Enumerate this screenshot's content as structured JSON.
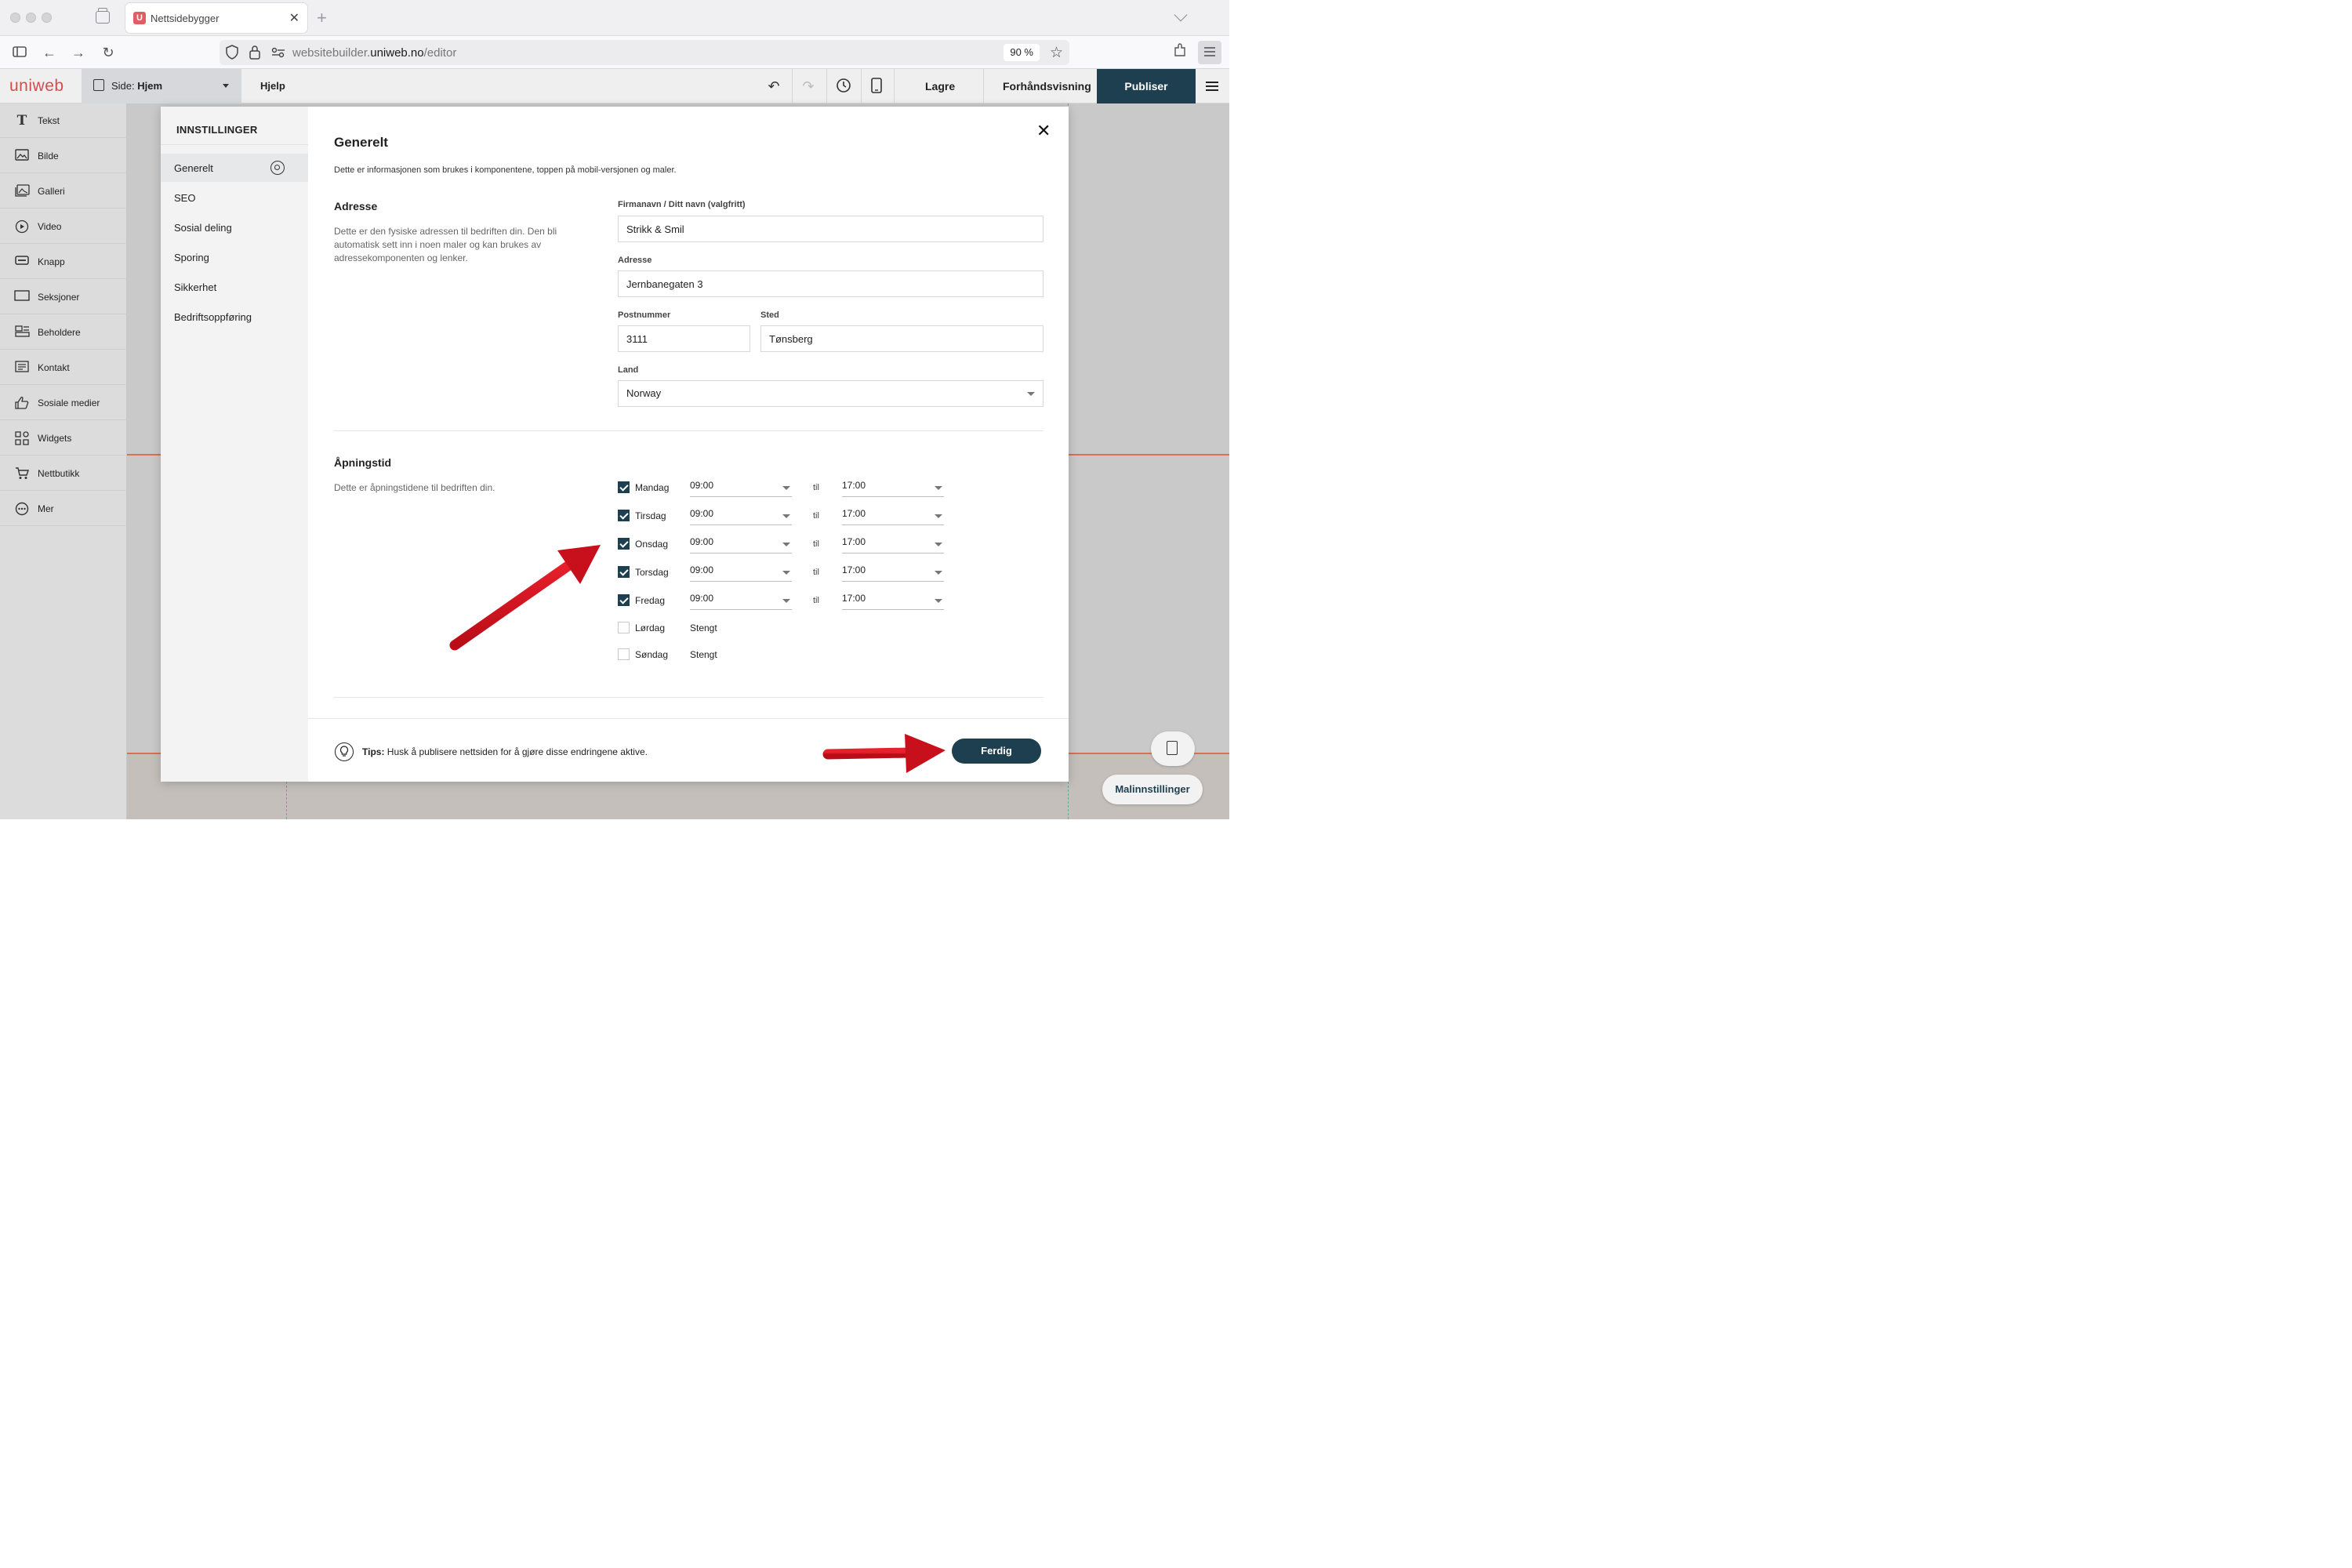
{
  "browser": {
    "tab_title": "Nettsidebygger",
    "tab_favicon_letter": "U",
    "url_host_prefix": "websitebuilder.",
    "url_host_main": "uniweb.no",
    "url_path": "/editor",
    "zoom": "90 %"
  },
  "editor": {
    "logo": "uniweb",
    "page_prefix": "Side:",
    "page_name": "Hjem",
    "help": "Hjelp",
    "save": "Lagre",
    "preview": "Forhåndsvisning",
    "publish": "Publiser"
  },
  "tools": [
    {
      "label": "Tekst",
      "icon": "text-icon"
    },
    {
      "label": "Bilde",
      "icon": "image-icon"
    },
    {
      "label": "Galleri",
      "icon": "gallery-icon"
    },
    {
      "label": "Video",
      "icon": "video-icon"
    },
    {
      "label": "Knapp",
      "icon": "button-icon"
    },
    {
      "label": "Seksjoner",
      "icon": "sections-icon"
    },
    {
      "label": "Beholdere",
      "icon": "containers-icon"
    },
    {
      "label": "Kontakt",
      "icon": "contact-icon"
    },
    {
      "label": "Sosiale medier",
      "icon": "thumbs-up-icon"
    },
    {
      "label": "Widgets",
      "icon": "widgets-icon"
    },
    {
      "label": "Nettbutikk",
      "icon": "cart-icon"
    },
    {
      "label": "Mer",
      "icon": "more-icon"
    }
  ],
  "settings": {
    "title": "INNSTILLINGER",
    "nav": [
      {
        "label": "Generelt",
        "active": true
      },
      {
        "label": "SEO"
      },
      {
        "label": "Sosial deling"
      },
      {
        "label": "Sporing"
      },
      {
        "label": "Sikkerhet"
      },
      {
        "label": "Bedriftsoppføring"
      }
    ],
    "heading": "Generelt",
    "intro": "Dette er informasjonen som brukes i komponentene, toppen på mobil-versjonen og maler.",
    "address": {
      "title": "Adresse",
      "description": "Dette er den fysiske adressen til bedriften din. Den bli automatisk sett inn i noen maler og kan brukes av adressekomponenten og lenker.",
      "company_label": "Firmanavn / Ditt navn (valgfritt)",
      "company_value": "Strikk & Smil",
      "street_label": "Adresse",
      "street_value": "Jernbanegaten 3",
      "zip_label": "Postnummer",
      "zip_value": "3111",
      "city_label": "Sted",
      "city_value": "Tønsberg",
      "country_label": "Land",
      "country_value": "Norway"
    },
    "hours": {
      "title": "Åpningstid",
      "description": "Dette er åpningstidene til bedriften din.",
      "til": "til",
      "days": [
        {
          "name": "Mandag",
          "open": true,
          "from": "09:00",
          "to": "17:00"
        },
        {
          "name": "Tirsdag",
          "open": true,
          "from": "09:00",
          "to": "17:00"
        },
        {
          "name": "Onsdag",
          "open": true,
          "from": "09:00",
          "to": "17:00"
        },
        {
          "name": "Torsdag",
          "open": true,
          "from": "09:00",
          "to": "17:00"
        },
        {
          "name": "Fredag",
          "open": true,
          "from": "09:00",
          "to": "17:00"
        },
        {
          "name": "Lørdag",
          "open": false,
          "closed_label": "Stengt"
        },
        {
          "name": "Søndag",
          "open": false,
          "closed_label": "Stengt"
        }
      ]
    },
    "tip_prefix": "Tips:",
    "tip_text": " Husk å publisere nettsiden for å gjøre disse endringene aktive.",
    "done": "Ferdig"
  },
  "floating": {
    "template_settings": "Malinnstillinger"
  },
  "colors": {
    "accent": "#1d3f50",
    "logo": "#d34d4d",
    "annotation_arrow": "#d0101e"
  }
}
